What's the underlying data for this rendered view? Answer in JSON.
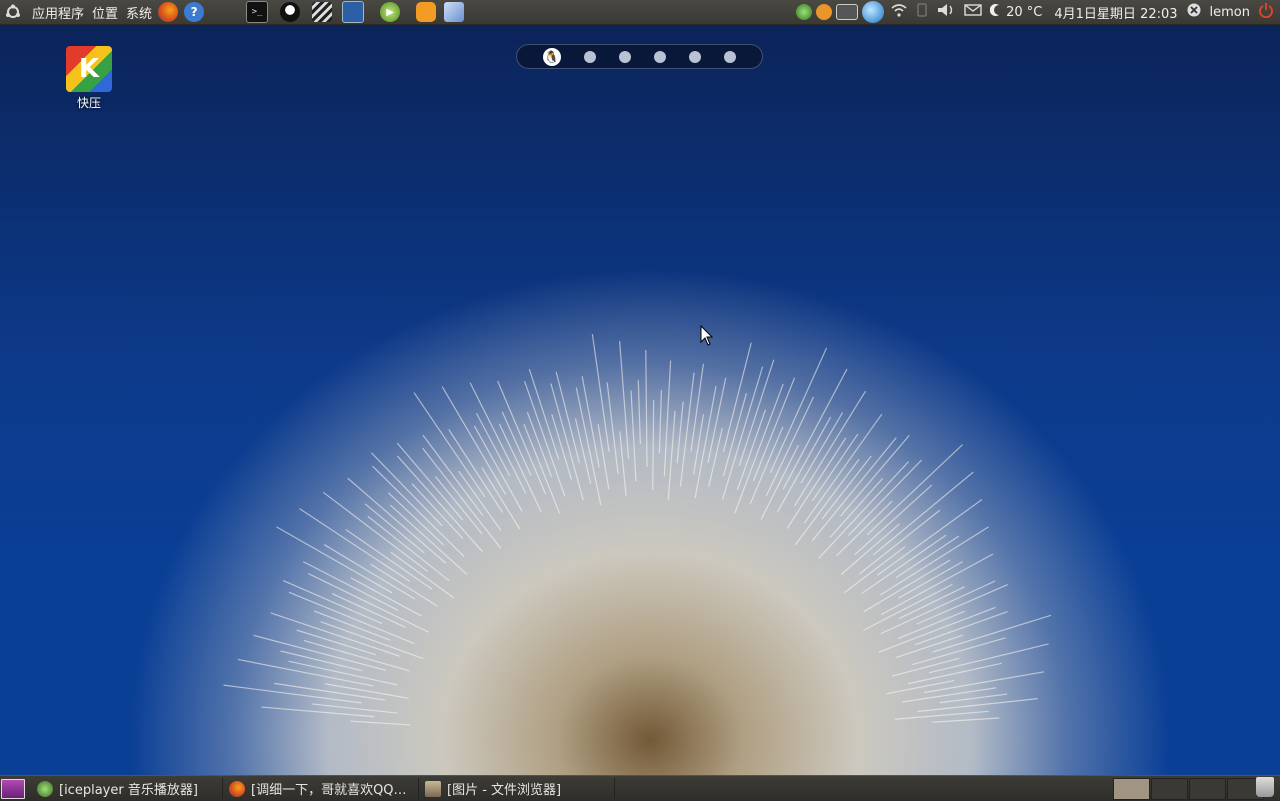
{
  "top_panel": {
    "menu": [
      "应用程序",
      "位置",
      "系统"
    ],
    "launchers": [
      {
        "icon": "firefox-icon"
      },
      {
        "icon": "help-icon",
        "glyph": "?"
      },
      {
        "icon": "terminal-icon",
        "glyph": ">_"
      },
      {
        "icon": "qq-penguin-icon"
      },
      {
        "icon": "video-clapper-icon"
      },
      {
        "icon": "system-monitor-icon"
      },
      {
        "icon": "media-play-icon",
        "glyph": "▶"
      },
      {
        "icon": "chat-face-icon"
      },
      {
        "icon": "cube-package-icon"
      }
    ],
    "tray": {
      "weather": "20 °C",
      "datetime": "4月1日星期日 22:03",
      "user": "lemon"
    }
  },
  "desktop": {
    "icon_label": "快压",
    "icon_glyph": "K"
  },
  "workspace_switcher": {
    "count": 6,
    "active": 0
  },
  "taskbar": {
    "tasks": [
      {
        "label": "[iceplayer 音乐播放器]",
        "icon": "iceplayer-icon"
      },
      {
        "label": "[调细一下，哥就喜欢QQ…",
        "icon": "firefox-icon"
      },
      {
        "label": "[图片 - 文件浏览器]",
        "icon": "file-browser-icon"
      }
    ],
    "pager_active": 0
  },
  "colors": {
    "panel": "#3a3934",
    "sky": "#0a3f96",
    "accent": "#e04a1f"
  }
}
